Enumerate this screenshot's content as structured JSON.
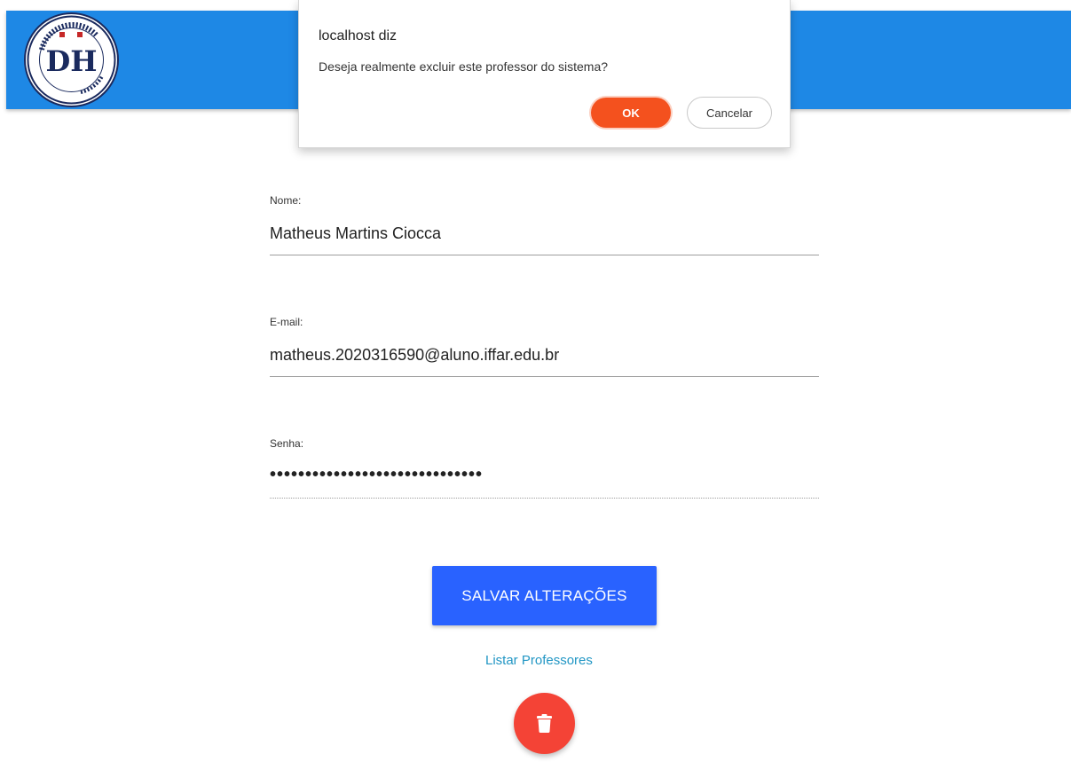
{
  "header": {
    "logo_text": "DH",
    "logo_ring_text": "ESCOLA ESTADUAL DOM HERMETO"
  },
  "dialog": {
    "title": "localhost diz",
    "message": "Deseja realmente excluir este professor do sistema?",
    "ok_label": "OK",
    "cancel_label": "Cancelar"
  },
  "form": {
    "name_label": "Nome:",
    "name_value": "Matheus Martins Ciocca",
    "email_label": "E-mail:",
    "email_value": "matheus.2020316590@aluno.iffar.edu.br",
    "password_label": "Senha:",
    "password_mask": "••••••••••••••••••••••••••••••",
    "save_label": "SALVAR ALTERAÇÕES",
    "list_link_label": "Listar Professores"
  },
  "colors": {
    "header": "#1e88e5",
    "ok_button": "#f4511e",
    "save_button": "#2962ff",
    "delete_button": "#f44336",
    "link": "#2196c4"
  },
  "icons": {
    "delete": "trash-icon",
    "logo": "school-logo"
  }
}
